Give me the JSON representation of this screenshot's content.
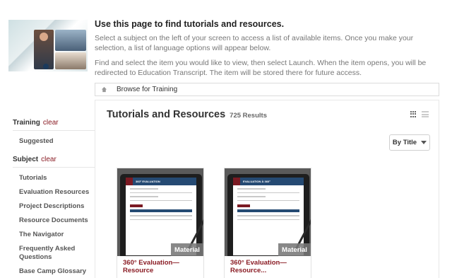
{
  "intro": {
    "heading": "Use this page to find tutorials and resources.",
    "para1": "Select a subject on the left of your screen to access a list of available items. Once you make your selection, a list of language options will appear below.",
    "para2": "Find and select the item you would like to view, then select Launch. When the item opens, you will be redirected to Education Transcript. The item will be stored there for future access."
  },
  "breadcrumb": {
    "label": "Browse for Training"
  },
  "sidebar": {
    "training": {
      "heading": "Training",
      "clear": "clear",
      "items": [
        "Suggested"
      ]
    },
    "subject": {
      "heading": "Subject",
      "clear": "clear",
      "items": [
        "Tutorials",
        "Evaluation Resources",
        "Project Descriptions",
        "Resource Documents",
        "The Navigator",
        "Frequently Asked Questions",
        "Base Camp Glossary"
      ]
    }
  },
  "main": {
    "title": "Tutorials and Resources",
    "count": "725 Results",
    "sort_label": "By Title",
    "cards": [
      {
        "title": "360° Evaluation—Resource",
        "badge": "Material",
        "screen_text": "360° EVALUATION"
      },
      {
        "title": "360° Evaluation—Resource...",
        "badge": "Material",
        "screen_text": "EVALUATION À 360°"
      }
    ]
  },
  "colors": {
    "accent": "#8a1c24",
    "navy": "#254a73"
  }
}
